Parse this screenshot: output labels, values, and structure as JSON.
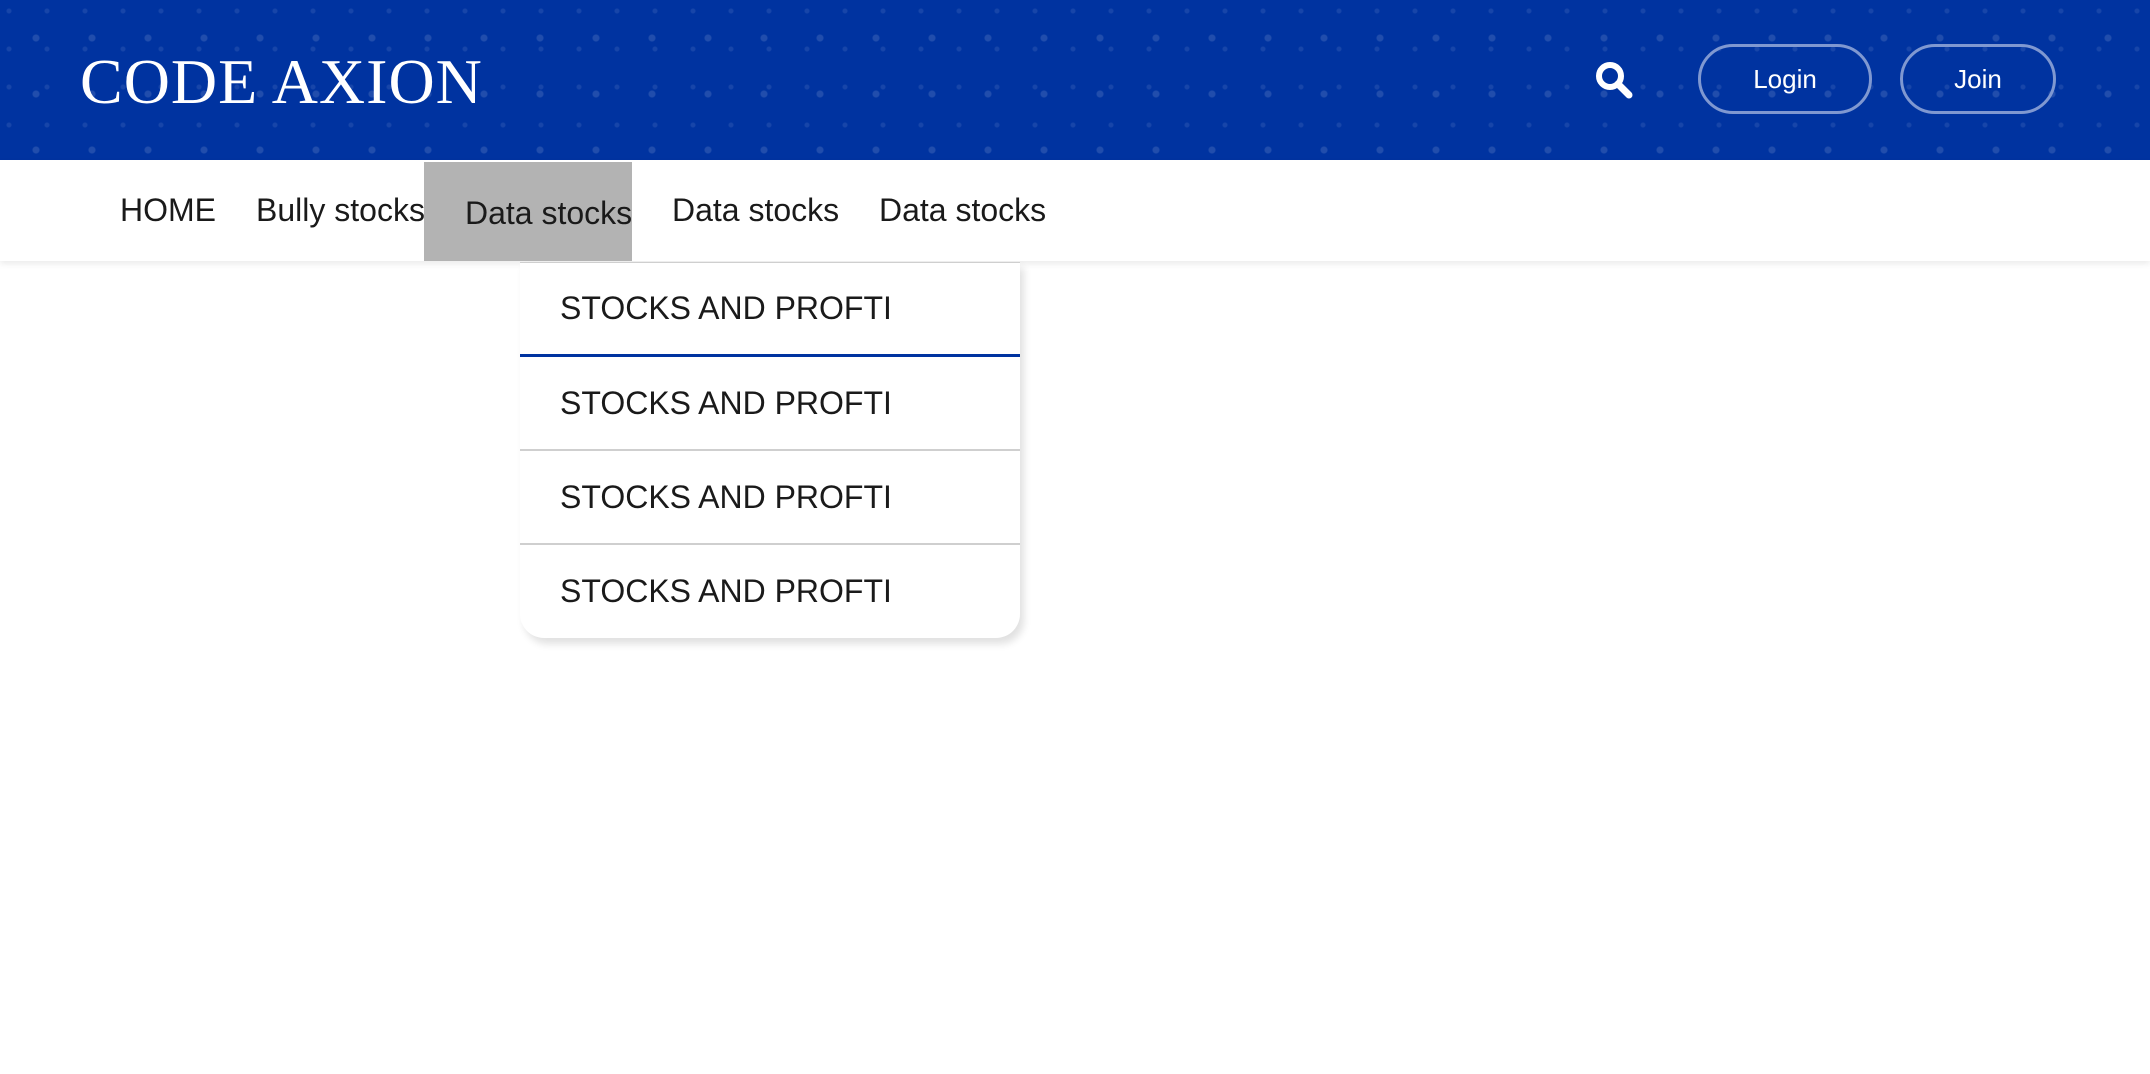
{
  "header": {
    "logo": "CODE AXION",
    "login_label": "Login",
    "join_label": "Join"
  },
  "icons": {
    "search": "search-icon"
  },
  "colors": {
    "header_bg": "#0033a0",
    "active_nav_bg": "#b3b3b3",
    "active_dropdown_underline": "#0033a0"
  },
  "nav": {
    "items": [
      {
        "label": "HOME"
      },
      {
        "label": "Bully stocks"
      },
      {
        "label": "Data stocks",
        "active": true
      },
      {
        "label": "Data stocks"
      },
      {
        "label": "Data stocks"
      }
    ]
  },
  "dropdown": {
    "items": [
      {
        "label": "STOCKS AND PROFTI"
      },
      {
        "label": "STOCKS AND PROFTI"
      },
      {
        "label": "STOCKS AND PROFTI"
      },
      {
        "label": "STOCKS AND PROFTI"
      }
    ]
  }
}
